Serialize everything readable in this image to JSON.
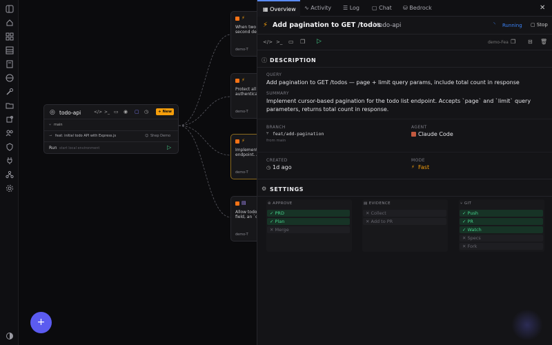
{
  "sidebar": {
    "icons": [
      "panel-icon",
      "home-icon",
      "grid-icon",
      "table-icon",
      "doc-icon",
      "globe-icon",
      "wrench-icon",
      "folder-icon",
      "puzzle-icon",
      "users-icon",
      "shield-icon",
      "plug-icon",
      "network-icon",
      "gear-icon",
      "theme-icon"
    ]
  },
  "repo_node": {
    "name": "todo-api",
    "new_label": "+ New",
    "branch": "main",
    "commit": "feat: initial todo API with Express.js",
    "author": "Shep Demo",
    "run_label": "Run",
    "run_hint": "start local environment"
  },
  "features": [
    {
      "line1": "When two",
      "line2": "second del",
      "tag": "demo-T"
    },
    {
      "line1": "Protect all",
      "line2": "authentica",
      "tag": "demo-T"
    },
    {
      "line1": "Implement",
      "line2": "endpoint. A",
      "tag": "demo-T"
    },
    {
      "line1": "Allow todo",
      "line2": "field, an `o",
      "tag": "demo-T"
    }
  ],
  "fab_label": "+",
  "panel": {
    "tabs": [
      {
        "label": "Overview"
      },
      {
        "label": "Activity"
      },
      {
        "label": "Log"
      },
      {
        "label": "Chat"
      },
      {
        "label": "Bedrock"
      }
    ],
    "title": "Add pagination to GET /todos",
    "repo": "todo-api",
    "status": "Running",
    "stop_label": "Stop",
    "env_tag": "demo-Fea",
    "description": {
      "heading": "DESCRIPTION",
      "query_label": "QUERY",
      "query": "Add pagination to GET /todos — page + limit query params, include total count in response",
      "summary_label": "SUMMARY",
      "summary": "Implement cursor-based pagination for the todo list endpoint. Accepts `page` and `limit` query parameters, returns total count in response."
    },
    "meta": {
      "branch_label": "BRANCH",
      "branch": "feat/add-pagination",
      "branch_from": "from main",
      "agent_label": "AGENT",
      "agent": "Claude Code",
      "created_label": "CREATED",
      "created": "1d ago",
      "mode_label": "MODE",
      "mode": "Fast"
    },
    "settings": {
      "heading": "SETTINGS",
      "approve": {
        "label": "APPROVE",
        "items": [
          {
            "t": "✓ PRD",
            "on": true
          },
          {
            "t": "✓ Plan",
            "on": true
          },
          {
            "t": "✕ Merge",
            "on": false
          }
        ]
      },
      "evidence": {
        "label": "EVIDENCE",
        "items": [
          {
            "t": "✕ Collect",
            "on": false
          },
          {
            "t": "✕ Add to PR",
            "on": false
          }
        ]
      },
      "git": {
        "label": "GIT",
        "items": [
          {
            "t": "✓ Push",
            "on": true
          },
          {
            "t": "✓ PR",
            "on": true
          },
          {
            "t": "✓ Watch",
            "on": true
          },
          {
            "t": "✕ Specs",
            "on": false
          },
          {
            "t": "✕ Fork",
            "on": false
          }
        ]
      }
    }
  },
  "colors": {
    "accent": "#5b5bf0",
    "status": "#3b82f6",
    "orange": "#f59e0b",
    "green": "#45d08a"
  }
}
